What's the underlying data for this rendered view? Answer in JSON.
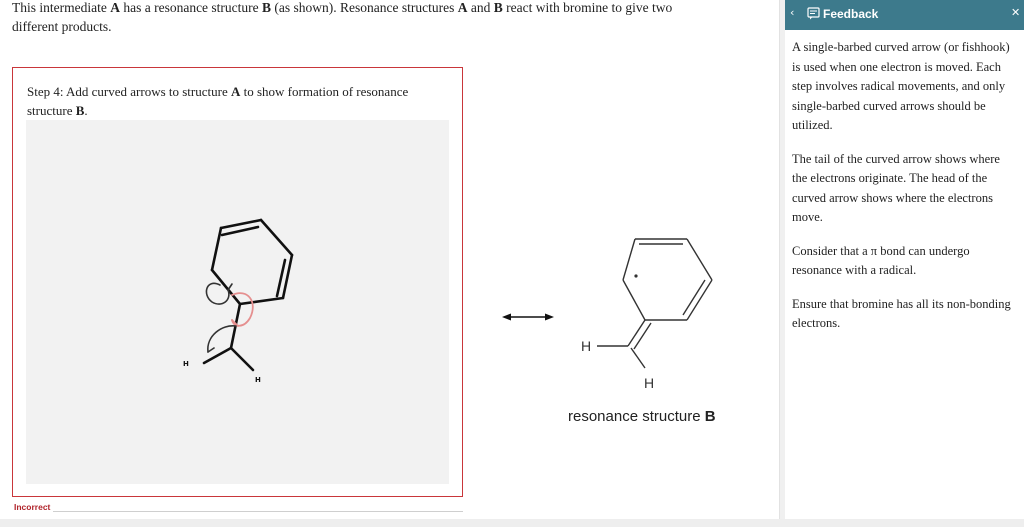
{
  "intro": {
    "part1": "This intermediate ",
    "a": "A",
    "part2": " has a resonance structure ",
    "b": "B",
    "part3": " (as shown). Resonance structures ",
    "a2": "A",
    "part4": " and ",
    "b2": "B",
    "part5": " react with bromine to give two different products."
  },
  "step": {
    "part1": "Step 4: Add curved arrows to structure ",
    "a": "A",
    "part2": " to show formation of resonance structure ",
    "b": "B",
    "part3": "."
  },
  "structure_a": {
    "h_left": "H",
    "h_bottom": "H"
  },
  "structure_b": {
    "h_left": "H",
    "h_bottom": "H"
  },
  "caption": {
    "text": "resonance structure ",
    "bold": "B"
  },
  "status": {
    "label": "Incorrect",
    "color": "#b0232a"
  },
  "feedback": {
    "title": "Feedback",
    "back_glyph": "‹",
    "close_glyph": "✕",
    "header_color": "#3d7a8c",
    "paragraphs": [
      "A single-barbed curved arrow (or fishhook) is used when one electron is moved. Each step involves radical movements, and only single-barbed curved arrows should be utilized.",
      "The tail of the curved arrow shows where the electrons originate. The head of the curved arrow shows where the electrons move.",
      "Consider that a π bond can undergo resonance with a radical.",
      "Ensure that bromine has all its non-bonding electrons."
    ]
  }
}
